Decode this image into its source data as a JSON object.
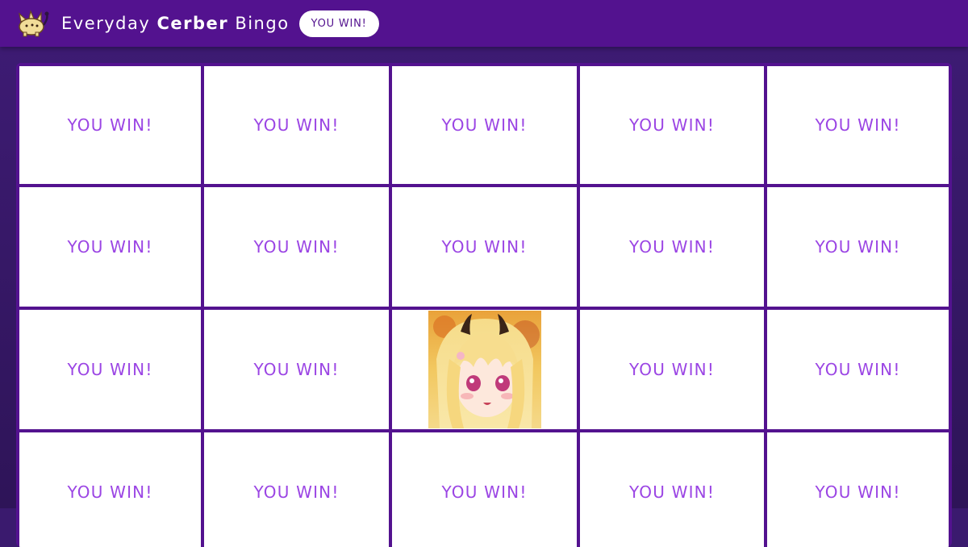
{
  "header": {
    "title_prefix": "Everyday ",
    "title_bold": "Cerber",
    "title_suffix": " Bingo",
    "win_badge": "YOU WIN!",
    "logo_icon": "cerber-mascot-icon"
  },
  "board": {
    "rows": [
      [
        "YOU WIN!",
        "YOU WIN!",
        "YOU WIN!",
        "YOU WIN!",
        "YOU WIN!"
      ],
      [
        "YOU WIN!",
        "YOU WIN!",
        "YOU WIN!",
        "YOU WIN!",
        "YOU WIN!"
      ],
      [
        "YOU WIN!",
        "YOU WIN!",
        "",
        "YOU WIN!",
        "YOU WIN!"
      ],
      [
        "YOU WIN!",
        "YOU WIN!",
        "YOU WIN!",
        "YOU WIN!",
        "YOU WIN!"
      ]
    ],
    "free_space_icon": "cerber-avatar-icon"
  },
  "colors": {
    "header_bg": "#53128f",
    "page_bg": "#3a1a6e",
    "grid_line": "#53128f",
    "cell_text": "#9b45e4",
    "pill_bg": "#ffffff"
  }
}
